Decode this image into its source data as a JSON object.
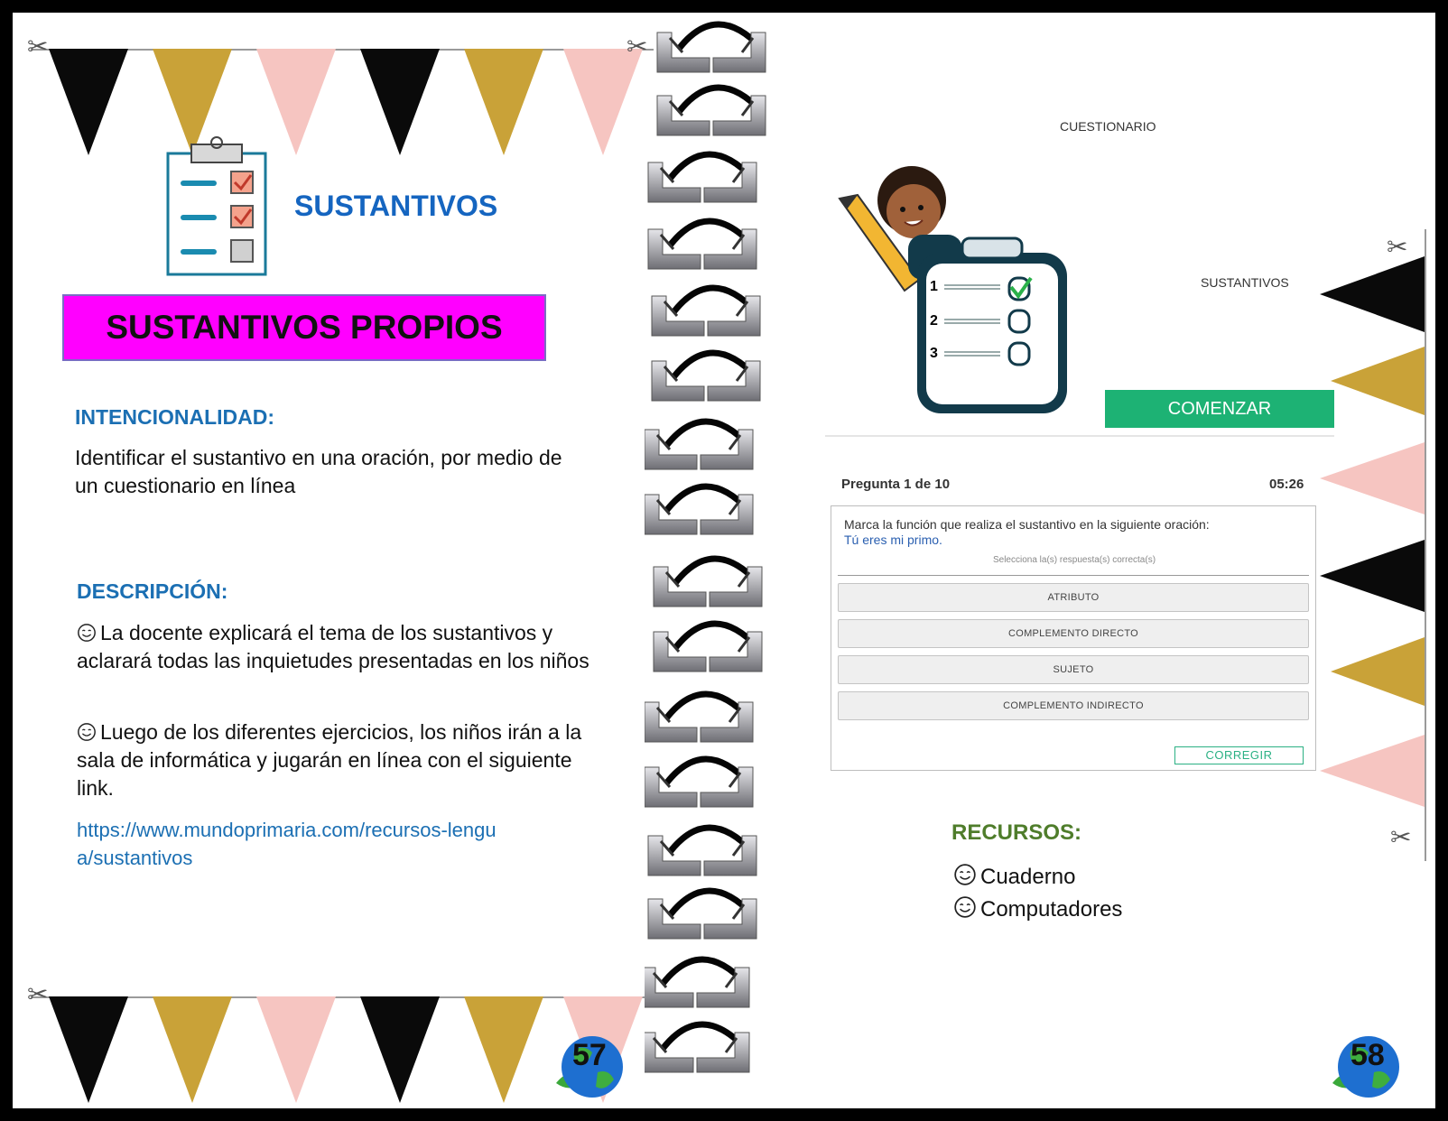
{
  "left_page": {
    "topic_title": "SUSTANTIVOS",
    "banner_title": "SUSTANTIVOS PROPIOS",
    "intention_heading": "INTENCIONALIDAD:",
    "intention_text": "Identificar el sustantivo en una oración, por medio de un cuestionario en línea",
    "description_heading": "DESCRIPCIÓN:",
    "description_items": [
      "La docente explicará el tema de los sustantivos y aclarará todas las inquietudes presentadas en los niños",
      "Luego de los diferentes ejercicios, los niños irán a la sala de informática y jugarán en línea con el siguiente link."
    ],
    "link": "https://www.mundoprimaria.com/recursos-lengua/sustantivos",
    "page_number": "57"
  },
  "right_page": {
    "quiz_label": "CUESTIONARIO",
    "quiz_topic": "SUSTANTIVOS",
    "start_button": "COMENZAR",
    "checklist_numbers": [
      "1",
      "2",
      "3"
    ],
    "question_counter": "Pregunta 1 de 10",
    "timer": "05:26",
    "question_prompt": "Marca la función que realiza el sustantivo en la siguiente oración:",
    "question_sentence": "Tú eres mi primo.",
    "instruction": "Selecciona la(s) respuesta(s) correcta(s)",
    "options": [
      "ATRIBUTO",
      "COMPLEMENTO DIRECTO",
      "SUJETO",
      "COMPLEMENTO INDIRECTO"
    ],
    "check_button": "CORREGIR",
    "resources_heading": "RECURSOS:",
    "resources": [
      "Cuaderno",
      "Computadores"
    ],
    "page_number": "58"
  },
  "colors": {
    "magenta_banner": "#ff00ff",
    "heading_blue": "#1b6fb3",
    "quiz_green": "#1db274",
    "resources_green": "#4f7d2b"
  }
}
